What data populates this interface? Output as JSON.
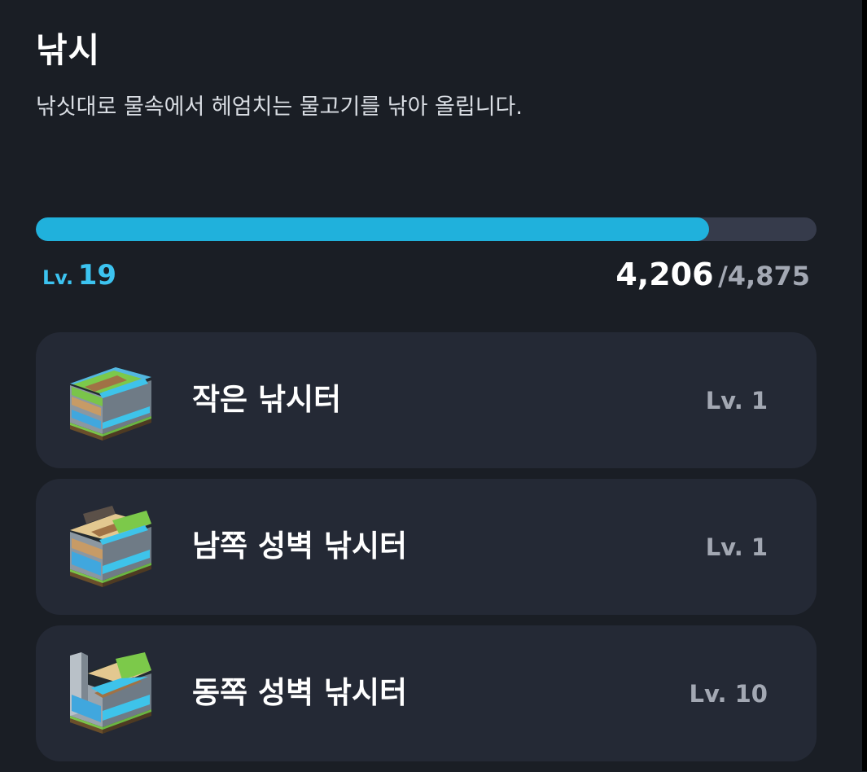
{
  "header": {
    "title": "낚시",
    "description": "낚싯대로 물속에서 헤엄치는 물고기를 낚아 올립니다."
  },
  "progress": {
    "level_prefix": "Lv.",
    "level": "19",
    "current_xp": "4,206",
    "max_xp": "/4,875",
    "fraction": 0.8628,
    "fill_color": "#20b1dc",
    "track_color": "#363b4b"
  },
  "spots": [
    {
      "name": "작은 낚시터",
      "level": "Lv. 1",
      "icon": "small-fishing-spot-icon"
    },
    {
      "name": "남쪽 성벽 낚시터",
      "level": "Lv. 1",
      "icon": "south-wall-fishing-spot-icon"
    },
    {
      "name": "동쪽 성벽 낚시터",
      "level": "Lv. 10",
      "icon": "east-wall-fishing-spot-icon"
    }
  ],
  "colors": {
    "background": "#1a1e25",
    "card": "#242935",
    "accent": "#3cc3f0",
    "muted": "#a3a8b3"
  }
}
